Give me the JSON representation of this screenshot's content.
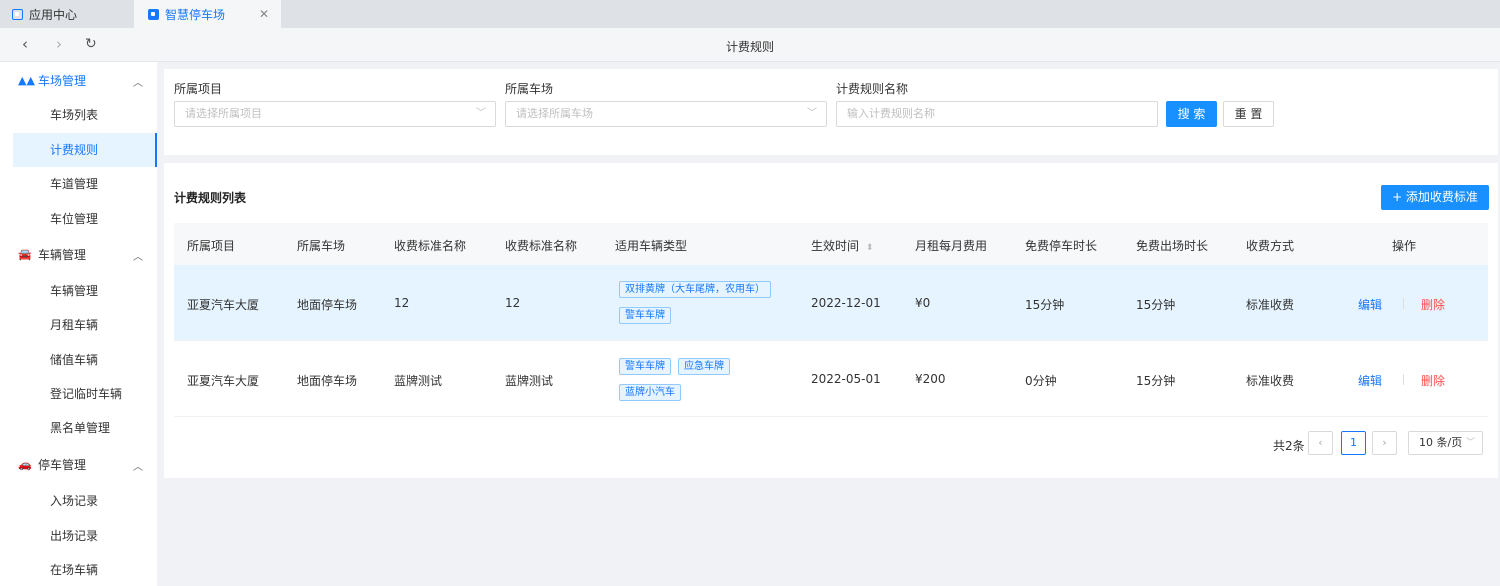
{
  "tabs": [
    {
      "label": "应用中心",
      "active": false
    },
    {
      "label": "智慧停车场",
      "active": true
    }
  ],
  "nav": {
    "title": "计费规则"
  },
  "sidebar": {
    "groups": [
      {
        "label": "车场管理",
        "icon": "road-icon",
        "items": [
          "车场列表",
          "计费规则",
          "车道管理",
          "车位管理"
        ]
      },
      {
        "label": "车辆管理",
        "icon": "car-icon",
        "items": [
          "车辆管理",
          "月租车辆",
          "储值车辆",
          "登记临时车辆",
          "黑名单管理"
        ]
      },
      {
        "label": "停车管理",
        "icon": "parking-icon",
        "items": [
          "入场记录",
          "出场记录",
          "在场车辆"
        ]
      }
    ],
    "active_item": "计费规则"
  },
  "filters": {
    "project": {
      "label": "所属项目",
      "placeholder": "请选择所属项目"
    },
    "lot": {
      "label": "所属车场",
      "placeholder": "请选择所属车场"
    },
    "rule_name": {
      "label": "计费规则名称",
      "placeholder": "输入计费规则名称"
    },
    "search_label": "搜 索",
    "reset_label": "重 置"
  },
  "list": {
    "title": "计费规则列表",
    "add_label": "+ 添加收费标准",
    "columns": [
      "所属项目",
      "所属车场",
      "收费标准名称",
      "收费标准名称",
      "适用车辆类型",
      "生效时间",
      "月租每月费用",
      "免费停车时长",
      "免费出场时长",
      "收费方式",
      "操作"
    ],
    "rows": [
      {
        "project": "亚夏汽车大厦",
        "lot": "地面停车场",
        "std_name": "12",
        "std_name2": "12",
        "tags": [
          "双排黄牌（大车尾牌，农用车）",
          "警车车牌"
        ],
        "effective": "2022-12-01",
        "monthly": "¥0",
        "free_park": "15分钟",
        "free_exit": "15分钟",
        "method": "标准收费",
        "edit": "编辑",
        "delete": "删除",
        "highlighted": true
      },
      {
        "project": "亚夏汽车大厦",
        "lot": "地面停车场",
        "std_name": "蓝牌测试",
        "std_name2": "蓝牌测试",
        "tags": [
          "警车车牌",
          "应急车牌",
          "蓝牌小汽车"
        ],
        "effective": "2022-05-01",
        "monthly": "¥200",
        "free_park": "0分钟",
        "free_exit": "15分钟",
        "method": "标准收费",
        "edit": "编辑",
        "delete": "删除",
        "highlighted": false
      }
    ]
  },
  "pagination": {
    "total": "共2条",
    "current": "1",
    "page_size": "10 条/页"
  },
  "colors": {
    "primary": "#1890ff",
    "danger": "#ff4d4f",
    "highlight_row": "#e6f4ff"
  }
}
